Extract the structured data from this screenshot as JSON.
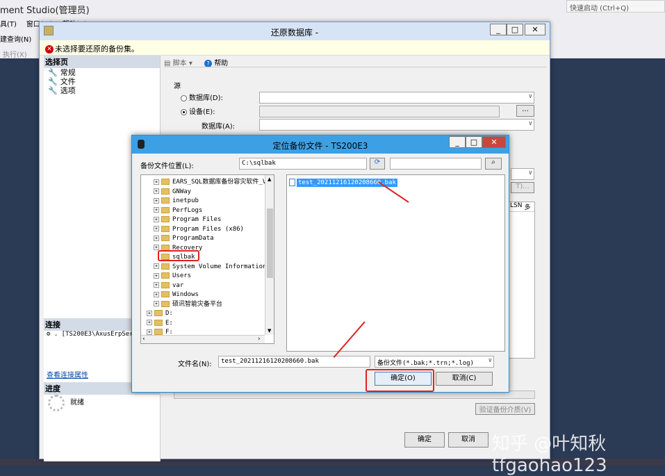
{
  "ssms": {
    "title": "ment Studio(管理员)",
    "menu": [
      "具(T)",
      "窗口(W)",
      "帮助(H)"
    ],
    "new_query": "建查询(N)",
    "execute": "执行(X)",
    "quick_launch": "快速启动 (Ctrl+Q)"
  },
  "restore": {
    "title": "还原数据库 -",
    "warning": "未选择要还原的备份集。",
    "left": {
      "select_page": "选择页",
      "items": [
        "常规",
        "文件",
        "选项"
      ],
      "connection": "连接",
      "conn_value": ". [TS200E3\\AxusErpSer",
      "view_conn": "查看连接属性",
      "progress": "进度",
      "ready": "就绪"
    },
    "toolbar": {
      "script": "脚本",
      "help": "帮助"
    },
    "source": "源",
    "database_radio": "数据库(D):",
    "device_radio": "设备(E):",
    "database_label": "数据库(A):",
    "browse": "...",
    "lsn": "LSN",
    "col2": "多",
    "timeline": "T)...",
    "verify": "验证备份介质(V)",
    "ok": "确定",
    "cancel": "取消"
  },
  "locate": {
    "title": "定位备份文件 - TS200E3",
    "location_label": "备份文件位置(L):",
    "location_value": "C:\\sqlbak",
    "tree": [
      "EARS_SQL数据库备份容灾软件_V",
      "GNWay",
      "inetpub",
      "PerfLogs",
      "Program Files",
      "Program Files (x86)",
      "ProgramData",
      "Recovery",
      "sqlbak",
      "System Volume Information",
      "Users",
      "var",
      "Windows",
      "硕讯智能灾备平台",
      "D:",
      "E:",
      "F:"
    ],
    "selected_file": "test_20211216120208660.bak",
    "filename_label": "文件名(N):",
    "filename_value": "test_20211216120208660.bak",
    "filter": "备份文件(*.bak;*.trn;*.log)",
    "ok": "确定(O)",
    "cancel": "取消(C)"
  },
  "watermark": "知乎 @叶知秋 tfgaohao123",
  "colors": {
    "accent": "#3ea0e4",
    "highlight": "#e02020",
    "selection": "#3399ff"
  }
}
